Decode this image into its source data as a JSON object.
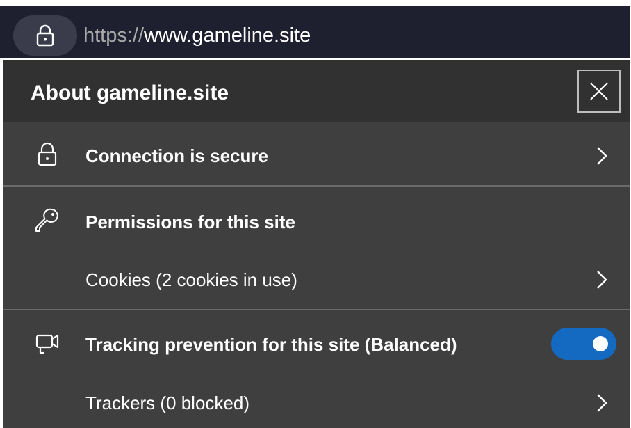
{
  "address_bar": {
    "url_scheme": "https://",
    "url_host": "www.gameline.site",
    "lock_icon": "lock-icon"
  },
  "site_info_panel": {
    "title": "About gameline.site",
    "close_icon": "close-icon",
    "connection": {
      "label": "Connection is secure",
      "icon": "lock-icon"
    },
    "permissions": {
      "label": "Permissions for this site",
      "icon": "key-icon"
    },
    "cookies": {
      "label": "Cookies (2 cookies in use)"
    },
    "tracking": {
      "label": "Tracking prevention for this site (Balanced)",
      "icon": "tracking-camera-icon",
      "enabled": true
    },
    "trackers": {
      "label": "Trackers (0 blocked)"
    }
  },
  "colors": {
    "address_bar_bg": "#1e2030",
    "panel_bg": "#3f3f3f",
    "header_bg": "#313131",
    "toggle_on": "#1469c1"
  }
}
